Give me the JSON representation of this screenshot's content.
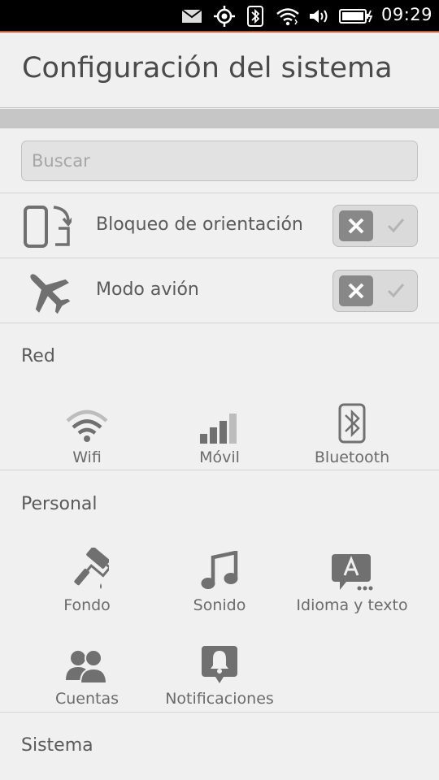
{
  "status_bar": {
    "time": "09:29",
    "icons": [
      "mail-icon",
      "location-icon",
      "bluetooth-icon",
      "wifi-icon",
      "volume-icon",
      "battery-charging-icon"
    ],
    "accent_color": "#d94f2a"
  },
  "header": {
    "title": "Configuración del sistema"
  },
  "search": {
    "placeholder": "Buscar"
  },
  "toggles": [
    {
      "label": "Bloqueo de orientación",
      "icon": "rotation-lock-icon",
      "on": false
    },
    {
      "label": "Modo avión",
      "icon": "airplane-icon",
      "on": false
    }
  ],
  "sections": {
    "red": {
      "title": "Red",
      "items": [
        {
          "label": "Wifi",
          "icon": "wifi-icon"
        },
        {
          "label": "Móvil",
          "icon": "cellular-signal-icon"
        },
        {
          "label": "Bluetooth",
          "icon": "bluetooth-icon"
        }
      ]
    },
    "personal": {
      "title": "Personal",
      "items": [
        {
          "label": "Fondo",
          "icon": "paint-roller-icon"
        },
        {
          "label": "Sonido",
          "icon": "music-note-icon"
        },
        {
          "label": "Idioma y texto",
          "icon": "language-icon"
        },
        {
          "label": "Cuentas",
          "icon": "accounts-icon"
        },
        {
          "label": "Notificaciones",
          "icon": "notification-bell-icon"
        }
      ]
    },
    "sistema": {
      "title": "Sistema"
    }
  }
}
